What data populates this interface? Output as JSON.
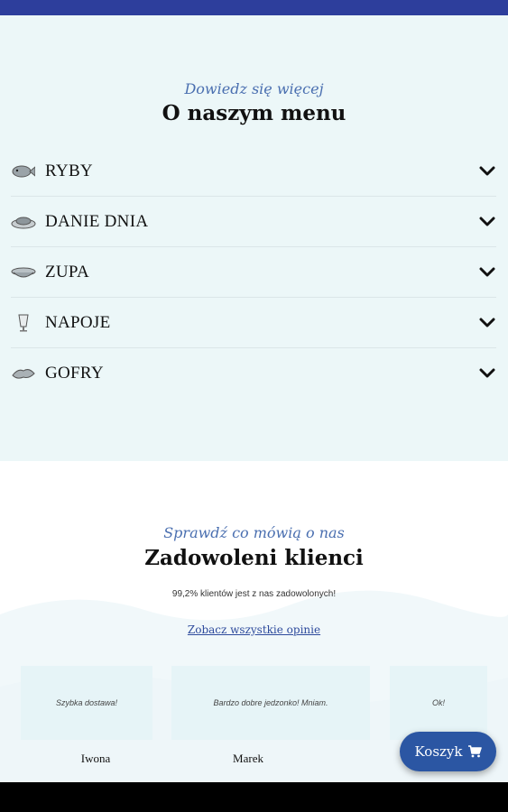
{
  "menu_section": {
    "eyebrow": "Dowiedz się więcej",
    "title": "O naszym menu",
    "items": [
      {
        "label": "RYBY",
        "icon": "fish-icon"
      },
      {
        "label": "DANIE DNIA",
        "icon": "dish-icon"
      },
      {
        "label": "ZUPA",
        "icon": "soup-icon"
      },
      {
        "label": "NAPOJE",
        "icon": "glass-icon"
      },
      {
        "label": "GOFRY",
        "icon": "waffle-icon"
      }
    ]
  },
  "reviews": {
    "eyebrow": "Sprawdź co mówią o nas",
    "title": "Zadowoleni klienci",
    "subtext": "99,2% klientów jest z nas zadowolonych!",
    "all_link": "Zobacz wszystkie opinie",
    "cards": [
      {
        "text": "Szybka dostawa!",
        "author": "Iwona"
      },
      {
        "text": "Bardzo dobre jedzonko! Mniam.",
        "author": "Marek"
      },
      {
        "text": "Ok!",
        "author": ""
      }
    ]
  },
  "cart": {
    "label": "Koszyk"
  },
  "colors": {
    "topbar": "#2d3e9c",
    "accent": "#2b56a3",
    "menu_bg": "#ecf7f8",
    "card_bg": "#e6f4f7"
  }
}
